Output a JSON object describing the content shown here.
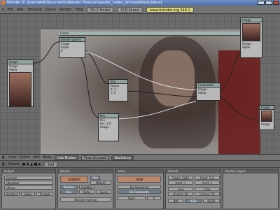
{
  "window": {
    "title": "Blender [C:\\Users\\Asif\\Documents\\Blender Files\\compositor_nodes_removed\\Paris.blend]"
  },
  "menubar": {
    "items": [
      "File",
      "Add",
      "Timeline",
      "Game",
      "Render",
      "Help"
    ],
    "screen": "SR:2-Model",
    "scene": "SCE:Scene",
    "site": "www.blender.org 249.1"
  },
  "nodes": {
    "render_layers": {
      "title": "Render Layers",
      "rows": [
        "Image",
        "Alpha",
        "Z"
      ]
    },
    "image_input": {
      "title": "Image",
      "rows": [
        "Image",
        "Alpha",
        "Z"
      ]
    },
    "image_right": {
      "title": "Image",
      "rows": [
        "Image",
        "Alpha",
        "Z"
      ]
    },
    "image_small": {
      "title": "Image",
      "rows": [
        "Image",
        "Alpha"
      ]
    },
    "frame": {
      "title": "Frame"
    },
    "blur": {
      "title": "Blur",
      "rows": [
        "Image",
        "Gauss",
        "Bokeh",
        "X: 5",
        "Y: 5"
      ]
    },
    "mix_top": {
      "title": "Mix",
      "rows": [
        "Image",
        "Add",
        "Fac: 0.5"
      ]
    },
    "mix_bottom": {
      "title": "Mix",
      "rows": [
        "Image",
        "Mix",
        "Fac: 1.0"
      ]
    },
    "composite": {
      "title": "Composite",
      "rows": [
        "Image",
        "Alpha",
        "Z"
      ]
    }
  },
  "node_header": {
    "items": [
      "View",
      "Select",
      "Add",
      "Node"
    ],
    "tabs": [
      "Use Nodes",
      "Free Unused",
      "Backdrop"
    ]
  },
  "buttons_header": {
    "items": [
      "Panels"
    ],
    "frame": "504"
  },
  "panels": {
    "output": {
      "title": "Output",
      "rows": [
        "//render_",
        "//backbuf",
        "//ftype"
      ],
      "buttons": [
        "Backbuf",
        "Edge",
        "Threads"
      ]
    },
    "render_layers": {
      "title": "Render Layers"
    },
    "render": {
      "title": "Render",
      "buttons": [
        "RENDER",
        "OSA",
        "MBLUR",
        "Shadow",
        "EnvMap",
        "Ray",
        "Radio",
        "Gauss",
        "Blender Internal"
      ]
    },
    "anim": {
      "title": "Anim",
      "buttons": [
        "ANIM",
        "Do Sequence",
        "Do Composite",
        "PLAY",
        "rt"
      ]
    },
    "format": {
      "title": "Format",
      "rows": [
        "SizeX: 1280",
        "SizeY: 720",
        "AspX: 1",
        "AspY: 1",
        "Quality: 90",
        "Frs/sec: 25"
      ],
      "buttons": [
        "Jpeg",
        "Crop",
        "BW",
        "RGB",
        "RGBA"
      ]
    }
  },
  "colors": {
    "accent_node_header": "#8fa3a0",
    "panel_bg": "#8a8a8a",
    "titlebar": "#4f6fa8"
  }
}
